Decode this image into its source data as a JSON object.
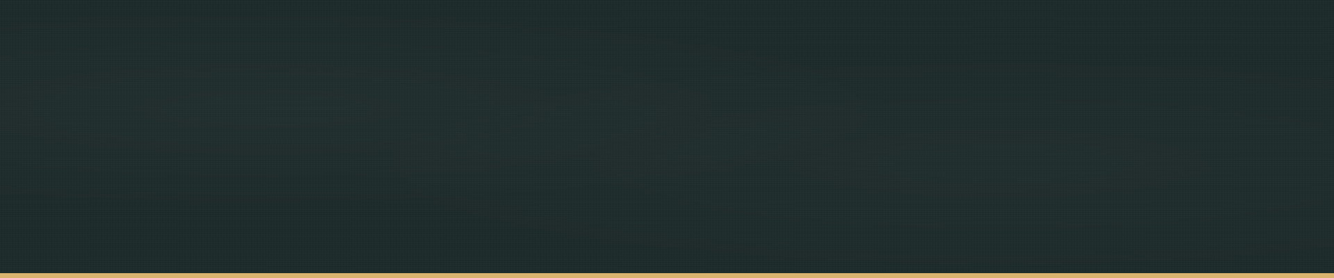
{
  "banner": {
    "background_color": "#1f2c2c",
    "accent_border_color": "#d9b46e"
  }
}
